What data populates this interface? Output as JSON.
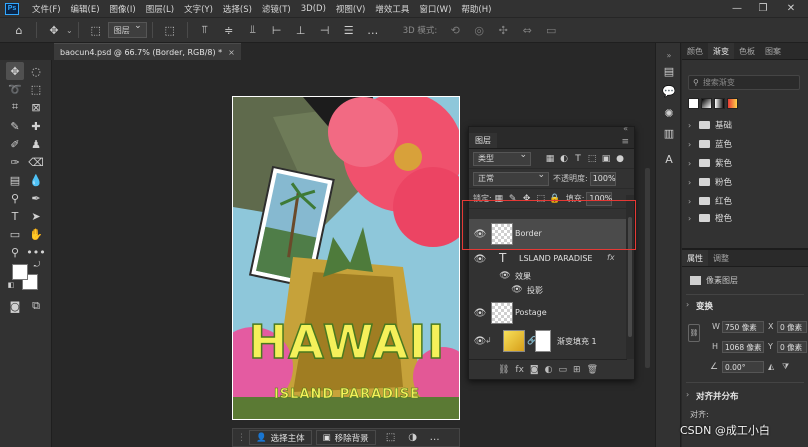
{
  "app": {
    "logo": "Ps",
    "menu": [
      "文件(F)",
      "编辑(E)",
      "图像(I)",
      "图层(L)",
      "文字(Y)",
      "选择(S)",
      "滤镜(T)",
      "3D(D)",
      "视图(V)",
      "增效工具",
      "窗口(W)",
      "帮助(H)"
    ],
    "window_controls": {
      "minimize": "—",
      "restore": "❐",
      "close": "✕"
    }
  },
  "options_bar": {
    "layer_select": "图层",
    "mode_3d_label": "3D 模式:"
  },
  "document": {
    "tab_title": "baocun4.psd @ 66.7% (Border, RGB/8) *",
    "close": "×"
  },
  "artwork": {
    "title": "HAWAII",
    "subtitle": "ISLAND PARADISE"
  },
  "context_bar": {
    "select_subject": "选择主体",
    "remove_background": "移除背景"
  },
  "layers_panel": {
    "tab": "图层",
    "kind_filter": "类型",
    "blend_mode": "正常",
    "opacity_label": "不透明度:",
    "opacity_value": "100%",
    "lock_label": "锁定:",
    "fill_label": "填充:",
    "fill_value": "100%",
    "layers": [
      {
        "name": "Border",
        "type": "pixel",
        "selected": true
      },
      {
        "name": "LSLAND PARADISE",
        "type": "text",
        "fx": "fx"
      },
      {
        "name": "效果",
        "type": "effects-group"
      },
      {
        "name": "投影",
        "type": "effect"
      },
      {
        "name": "Postage",
        "type": "pixel"
      },
      {
        "name": "渐变填充 1",
        "type": "gradient-fill"
      }
    ]
  },
  "right_panel": {
    "tabs": [
      "颜色",
      "渐变",
      "色板",
      "图案"
    ],
    "active_tab": "渐变",
    "search_placeholder": "搜索渐变",
    "folders": [
      "基础",
      "蓝色",
      "紫色",
      "粉色",
      "红色",
      "橙色"
    ]
  },
  "properties_panel": {
    "tabs": [
      "属性",
      "调整"
    ],
    "layer_type": "像素图层",
    "transform_header": "变换",
    "w_label": "W",
    "w_value": "750 像素",
    "x_label": "X",
    "x_value": "0 像素",
    "h_label": "H",
    "h_value": "1068 像素",
    "y_label": "Y",
    "y_value": "0 像素",
    "angle_value": "0.00°",
    "align_header": "对齐并分布",
    "align_label": "对齐:"
  },
  "watermark": "CSDN @成工小白",
  "colors": {
    "accent_blue": "#31a8ff",
    "highlight_red": "#e53935",
    "selected_layer": "#4b4b4b",
    "panel_bg": "#323232",
    "canvas_bg": "#282828"
  }
}
